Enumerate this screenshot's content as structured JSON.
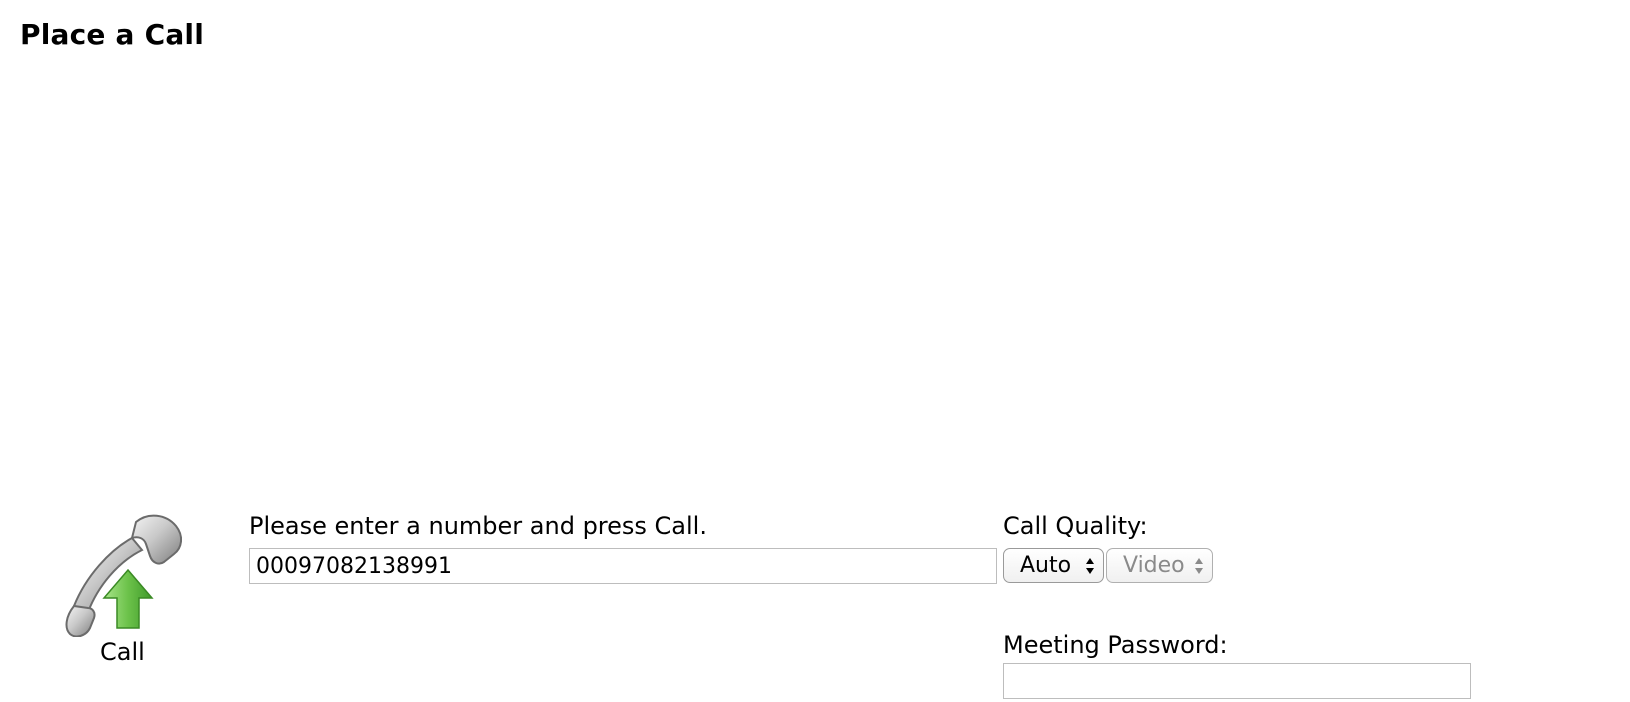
{
  "page": {
    "title": "Place a Call"
  },
  "call": {
    "label": "Call",
    "icon": "phone-handset-up-arrow-icon",
    "arrow_color": "#6cc24a"
  },
  "dial": {
    "prompt": "Please enter a number and press Call.",
    "number_value": "00097082138991",
    "placeholder": ""
  },
  "quality": {
    "label": "Call Quality:",
    "selected": "Auto",
    "media": "Video",
    "media_disabled": true
  },
  "meeting": {
    "password_label": "Meeting Password:",
    "password_value": ""
  }
}
